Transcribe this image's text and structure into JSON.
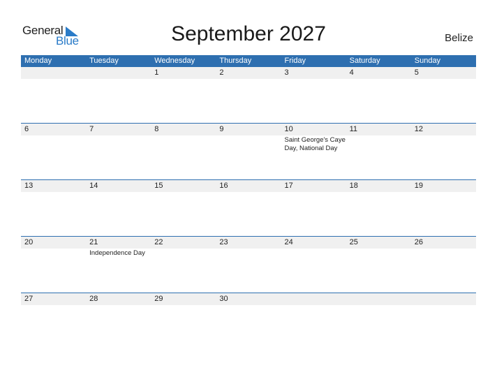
{
  "logo": {
    "line1": "General",
    "line2": "Blue"
  },
  "title": "September 2027",
  "country": "Belize",
  "colors": {
    "accent": "#2e6fb0",
    "date_bar": "#f0f0f0",
    "logo_blue": "#2a7bc8"
  },
  "weekdays": [
    "Monday",
    "Tuesday",
    "Wednesday",
    "Thursday",
    "Friday",
    "Saturday",
    "Sunday"
  ],
  "weeks": [
    {
      "days": [
        {
          "date": "",
          "holiday": ""
        },
        {
          "date": "",
          "holiday": ""
        },
        {
          "date": "1",
          "holiday": ""
        },
        {
          "date": "2",
          "holiday": ""
        },
        {
          "date": "3",
          "holiday": ""
        },
        {
          "date": "4",
          "holiday": ""
        },
        {
          "date": "5",
          "holiday": ""
        }
      ]
    },
    {
      "days": [
        {
          "date": "6",
          "holiday": ""
        },
        {
          "date": "7",
          "holiday": ""
        },
        {
          "date": "8",
          "holiday": ""
        },
        {
          "date": "9",
          "holiday": ""
        },
        {
          "date": "10",
          "holiday": "Saint George's Caye Day, National Day"
        },
        {
          "date": "11",
          "holiday": ""
        },
        {
          "date": "12",
          "holiday": ""
        }
      ]
    },
    {
      "days": [
        {
          "date": "13",
          "holiday": ""
        },
        {
          "date": "14",
          "holiday": ""
        },
        {
          "date": "15",
          "holiday": ""
        },
        {
          "date": "16",
          "holiday": ""
        },
        {
          "date": "17",
          "holiday": ""
        },
        {
          "date": "18",
          "holiday": ""
        },
        {
          "date": "19",
          "holiday": ""
        }
      ]
    },
    {
      "days": [
        {
          "date": "20",
          "holiday": ""
        },
        {
          "date": "21",
          "holiday": "Independence Day"
        },
        {
          "date": "22",
          "holiday": ""
        },
        {
          "date": "23",
          "holiday": ""
        },
        {
          "date": "24",
          "holiday": ""
        },
        {
          "date": "25",
          "holiday": ""
        },
        {
          "date": "26",
          "holiday": ""
        }
      ]
    },
    {
      "days": [
        {
          "date": "27",
          "holiday": ""
        },
        {
          "date": "28",
          "holiday": ""
        },
        {
          "date": "29",
          "holiday": ""
        },
        {
          "date": "30",
          "holiday": ""
        },
        {
          "date": "",
          "holiday": ""
        },
        {
          "date": "",
          "holiday": ""
        },
        {
          "date": "",
          "holiday": ""
        }
      ]
    }
  ]
}
